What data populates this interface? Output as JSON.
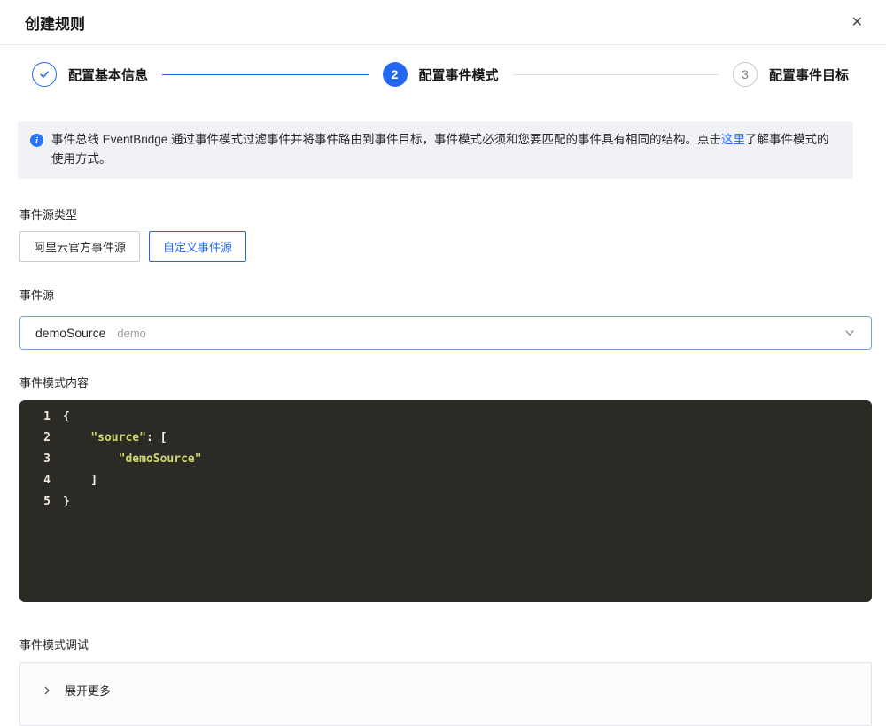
{
  "header": {
    "title": "创建规则",
    "close_glyph": "✕"
  },
  "steps": [
    {
      "label": "配置基本信息",
      "state": "done"
    },
    {
      "number": "2",
      "label": "配置事件模式",
      "state": "current"
    },
    {
      "number": "3",
      "label": "配置事件目标",
      "state": "upcoming"
    }
  ],
  "banner": {
    "text_before_link": "事件总线 EventBridge 通过事件模式过滤事件并将事件路由到事件目标，事件模式必须和您要匹配的事件具有相同的结构。点击",
    "link_text": "这里",
    "text_after_link": "了解事件模式的使用方式。"
  },
  "source_type": {
    "label": "事件源类型",
    "options": [
      {
        "label": "阿里云官方事件源",
        "selected": false
      },
      {
        "label": "自定义事件源",
        "selected": true
      }
    ]
  },
  "source": {
    "label": "事件源",
    "value": "demoSource",
    "description": "demo"
  },
  "pattern_editor": {
    "label": "事件模式内容",
    "lines": [
      {
        "num": "1",
        "segments": [
          {
            "t": "{",
            "c": "plain"
          }
        ]
      },
      {
        "num": "2",
        "segments": [
          {
            "t": "    ",
            "c": "plain"
          },
          {
            "t": "\"source\"",
            "c": "string"
          },
          {
            "t": ": [",
            "c": "plain"
          }
        ]
      },
      {
        "num": "3",
        "segments": [
          {
            "t": "        ",
            "c": "plain"
          },
          {
            "t": "\"demoSource\"",
            "c": "string"
          }
        ]
      },
      {
        "num": "4",
        "segments": [
          {
            "t": "    ]",
            "c": "plain"
          }
        ]
      },
      {
        "num": "5",
        "segments": [
          {
            "t": "}",
            "c": "plain"
          }
        ]
      }
    ]
  },
  "debug": {
    "label": "事件模式调试",
    "expand_label": "展开更多"
  },
  "colors": {
    "primary": "#2468f2",
    "link": "#2973f5",
    "banner_bg": "#f0f2f6",
    "editor_bg": "#2b2a25",
    "editor_string": "#ccd871",
    "editor_plain": "#f4f3ee"
  }
}
